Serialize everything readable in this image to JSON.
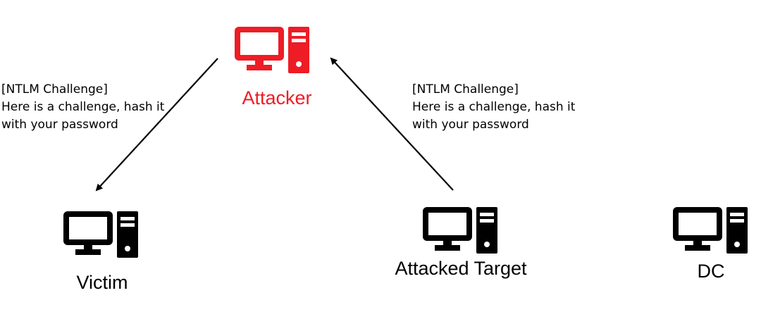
{
  "colors": {
    "attacker": "#ee1c25",
    "default": "#000000",
    "arrow": "#000000"
  },
  "nodes": {
    "attacker": {
      "label": "Attacker",
      "icon": "computer-icon"
    },
    "victim": {
      "label": "Victim",
      "icon": "computer-icon"
    },
    "target": {
      "label": "Attacked Target",
      "icon": "computer-icon"
    },
    "dc": {
      "label": "DC",
      "icon": "computer-icon"
    }
  },
  "notes": {
    "left": {
      "line1": "[NTLM Challenge]",
      "line2": "Here is a challenge, hash it",
      "line3": "with your password"
    },
    "right": {
      "line1": "[NTLM Challenge]",
      "line2": "Here is a challenge, hash it",
      "line3": "with your password"
    }
  },
  "edges": [
    {
      "from": "attacker",
      "to": "victim"
    },
    {
      "from": "target",
      "to": "attacker"
    }
  ]
}
